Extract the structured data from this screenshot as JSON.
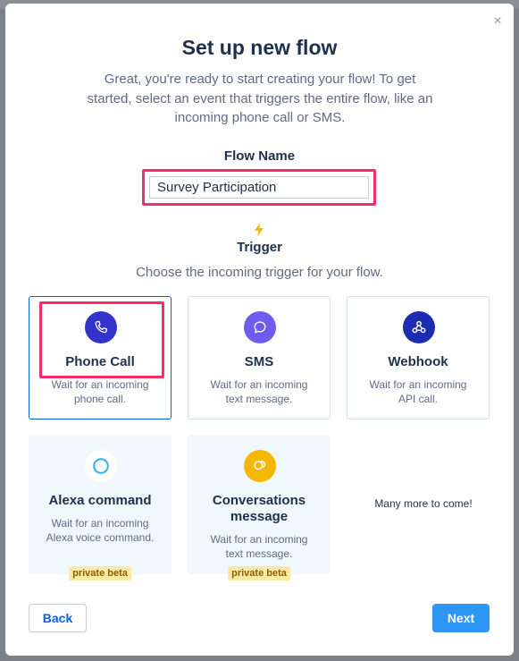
{
  "modal": {
    "close_glyph": "×",
    "title": "Set up new flow",
    "subtitle": "Great, you're ready to start creating your flow! To get started, select an event that triggers the entire flow, like an incoming phone call or SMS."
  },
  "flow_name": {
    "label": "Flow Name",
    "value": "Survey Participation"
  },
  "trigger": {
    "label": "Trigger",
    "description": "Choose the incoming trigger for your flow.",
    "icon": "lightning-bolt-icon"
  },
  "cards": [
    {
      "name": "Phone Call",
      "desc": "Wait for an incoming phone call.",
      "icon": "phone-icon",
      "selected": true
    },
    {
      "name": "SMS",
      "desc": "Wait for an incoming text message.",
      "icon": "chat-bubble-icon"
    },
    {
      "name": "Webhook",
      "desc": "Wait for an incoming API call.",
      "icon": "webhook-icon"
    },
    {
      "name": "Alexa command",
      "desc": "Wait for an incoming Alexa voice command.",
      "icon": "alexa-icon",
      "badge": "private beta"
    },
    {
      "name": "Conversations message",
      "desc": "Wait for an incoming text message.",
      "icon": "conversations-icon",
      "badge": "private beta"
    }
  ],
  "more_text": "Many more to come!",
  "buttons": {
    "back": "Back",
    "next": "Next"
  },
  "colors": {
    "primary": "#0263e0",
    "next_button": "#2e96f5",
    "highlight": "#f22f6a",
    "phone_circle": "#3333cc",
    "sms_circle": "#6e5bf0",
    "webhook_circle": "#1d2bb0",
    "conversations_circle": "#f5b800",
    "beta_badge": "#fde9a6"
  }
}
